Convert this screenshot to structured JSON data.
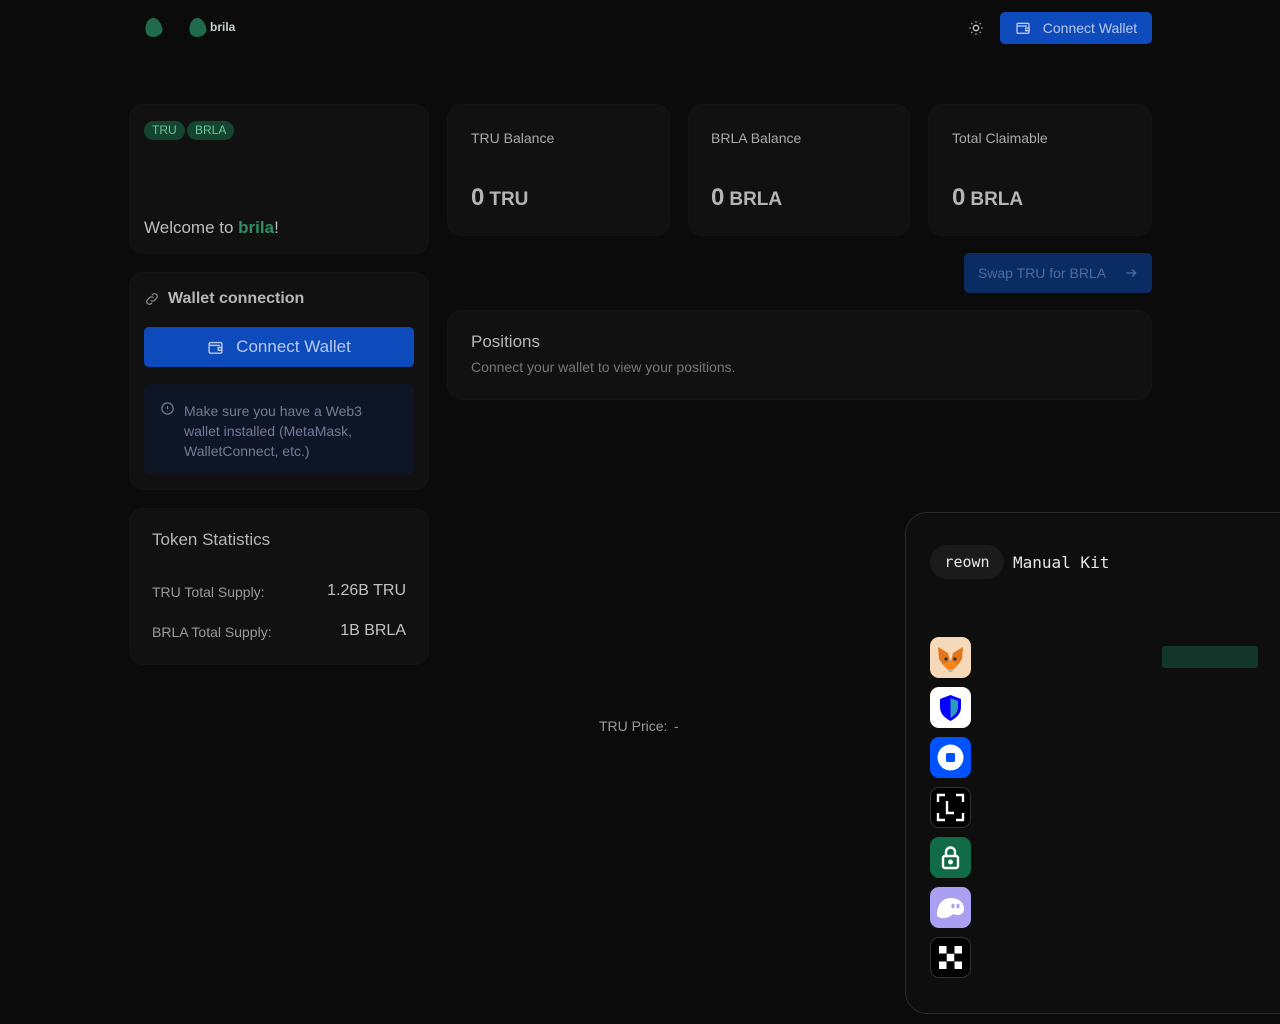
{
  "header": {
    "brand": "brila",
    "connect_label": "Connect Wallet",
    "theme_icon": "sun-icon"
  },
  "hero": {
    "badges": [
      "TRU",
      "BRLA"
    ],
    "welcome_prefix": "Welcome to ",
    "welcome_brand": "brila",
    "welcome_suffix": "!"
  },
  "balances": [
    {
      "label": "TRU Balance",
      "value": "0",
      "unit": "TRU"
    },
    {
      "label": "BRLA Balance",
      "value": "0",
      "unit": "BRLA"
    },
    {
      "label": "Total Claimable",
      "value": "0",
      "unit": "BRLA"
    }
  ],
  "wallet_connection": {
    "title": "Wallet connection",
    "button_label": "Connect Wallet",
    "info": "Make sure you have a Web3 wallet installed (MetaMask, WalletConnect, etc.)"
  },
  "swap": {
    "label": "Swap TRU for BRLA"
  },
  "positions": {
    "title": "Positions",
    "subtitle": "Connect your wallet to view your positions."
  },
  "token_stats": {
    "title": "Token Statistics",
    "rows": [
      {
        "label": "TRU Total Supply:",
        "value": "1.26B TRU"
      },
      {
        "label": "BRLA Total Supply:",
        "value": "1B BRLA"
      }
    ]
  },
  "price": {
    "label": "TRU Price:",
    "value": "-"
  },
  "kit_panel": {
    "logo": "reown",
    "title": "Manual Kit",
    "wallets": [
      "metamask-icon",
      "trust-wallet-icon",
      "coinbase-wallet-icon",
      "ledger-icon",
      "safe-icon",
      "phantom-icon",
      "okx-icon"
    ]
  },
  "colors": {
    "accent": "#0d4bbd",
    "brand_green": "#2f8f62",
    "background": "#0b0b0b",
    "card": "#111111"
  }
}
